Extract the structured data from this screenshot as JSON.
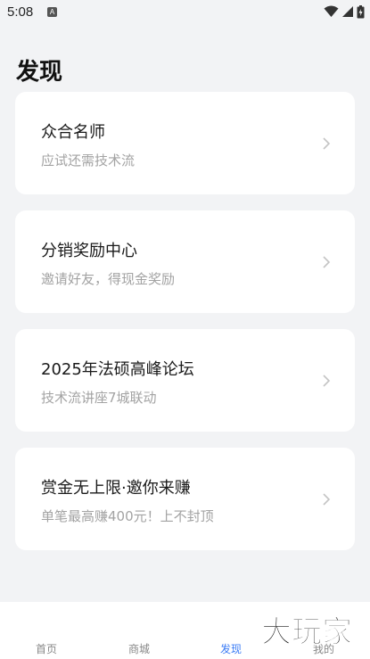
{
  "status_bar": {
    "time": "5:08",
    "notification_glyph": "A",
    "icons": [
      "wifi-icon",
      "signal-icon",
      "battery-icon"
    ]
  },
  "page": {
    "title": "发现"
  },
  "cards": [
    {
      "title": "众合名师",
      "subtitle": "应试还需技术流"
    },
    {
      "title": "分销奖励中心",
      "subtitle": "邀请好友，得现金奖励"
    },
    {
      "title": "2025年法硕高峰论坛",
      "subtitle": "技术流讲座7城联动"
    },
    {
      "title": "赏金无上限·邀你来赚",
      "subtitle": "单笔最高赚400元！上不封顶"
    }
  ],
  "tab_bar": {
    "tabs": [
      {
        "label": "首页",
        "active": false
      },
      {
        "label": "商城",
        "active": false
      },
      {
        "label": "发现",
        "active": true
      },
      {
        "label": "我的",
        "active": false
      }
    ],
    "active_color": "#3b7cf5"
  },
  "watermark": {
    "text": "大玩家"
  }
}
